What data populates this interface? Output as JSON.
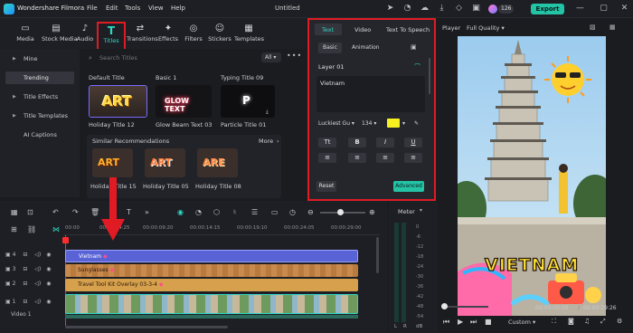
{
  "app": {
    "title": "Wondershare Filmora",
    "document_title": "Untitled",
    "menu": [
      "File",
      "Edit",
      "Tools",
      "View",
      "Help"
    ],
    "credits": "126",
    "export_label": "Export"
  },
  "toolbar": {
    "items": [
      "Media",
      "Stock Media",
      "Audio",
      "Titles",
      "Transitions",
      "Effects",
      "Filters",
      "Stickers",
      "Templates"
    ],
    "active": "Titles"
  },
  "sidebar": {
    "items": [
      "Mine",
      "Trending",
      "Title Effects",
      "Title Templates",
      "AI Captions"
    ],
    "selected": "Trending"
  },
  "browser": {
    "search_placeholder": "Search Titles",
    "filter": "All",
    "section_labels": [
      "Default Title",
      "Basic 1",
      "Typing Title 09"
    ],
    "thumbnails": [
      {
        "caption": "Holiday Title 12",
        "art": "ART"
      },
      {
        "caption": "Glow Beam Text 03",
        "art": "GLOW TEXT"
      },
      {
        "caption": "Particle Title 01",
        "art": "P"
      }
    ],
    "similar_header": "Similar Recommendations",
    "similar_more": "More",
    "similar_items": [
      {
        "caption": "Holiday Title 15",
        "art": "ART"
      },
      {
        "caption": "Holiday Title 05",
        "art": "ART"
      },
      {
        "caption": "Holiday Title 08",
        "art": "ARE"
      }
    ]
  },
  "properties": {
    "tabs": [
      "Text",
      "Video",
      "Text To Speech"
    ],
    "active_tab": "Text",
    "subtabs": [
      "Basic",
      "Animation"
    ],
    "active_subtab": "Basic",
    "layer": "Layer 01",
    "text_value": "Vietnam",
    "font": "Luckiest Gu",
    "size": "134",
    "color": "#f7f021",
    "format_buttons": [
      "B",
      "I",
      "U"
    ],
    "reset_label": "Reset",
    "advanced_label": "Advanced"
  },
  "player": {
    "label": "Player",
    "quality": "Full Quality",
    "overlay_text": "VIETNAM",
    "time_current": "00:00:00:00",
    "time_total": "00:00:29:26",
    "zoom": "Custom"
  },
  "timeline": {
    "ruler": [
      "00:00",
      "00:00:04:25",
      "00:00:09:20",
      "00:00:14:15",
      "00:00:19:10",
      "00:00:24:05",
      "00:00:29:00"
    ],
    "tracks": [
      {
        "label": "Vietnam",
        "track": "4"
      },
      {
        "label": "Sunglasses",
        "track": "3"
      },
      {
        "label": "Travel Tool Kit Overlay 03-3-4",
        "track": "2"
      },
      {
        "label": "Video 1",
        "track": "1"
      }
    ],
    "meter_label": "Meter",
    "meter_scale": [
      "0",
      "-6",
      "-12",
      "-18",
      "-24",
      "-30",
      "-36",
      "-42",
      "-48",
      "-54"
    ],
    "lr": [
      "L",
      "R"
    ],
    "db": "dB"
  }
}
